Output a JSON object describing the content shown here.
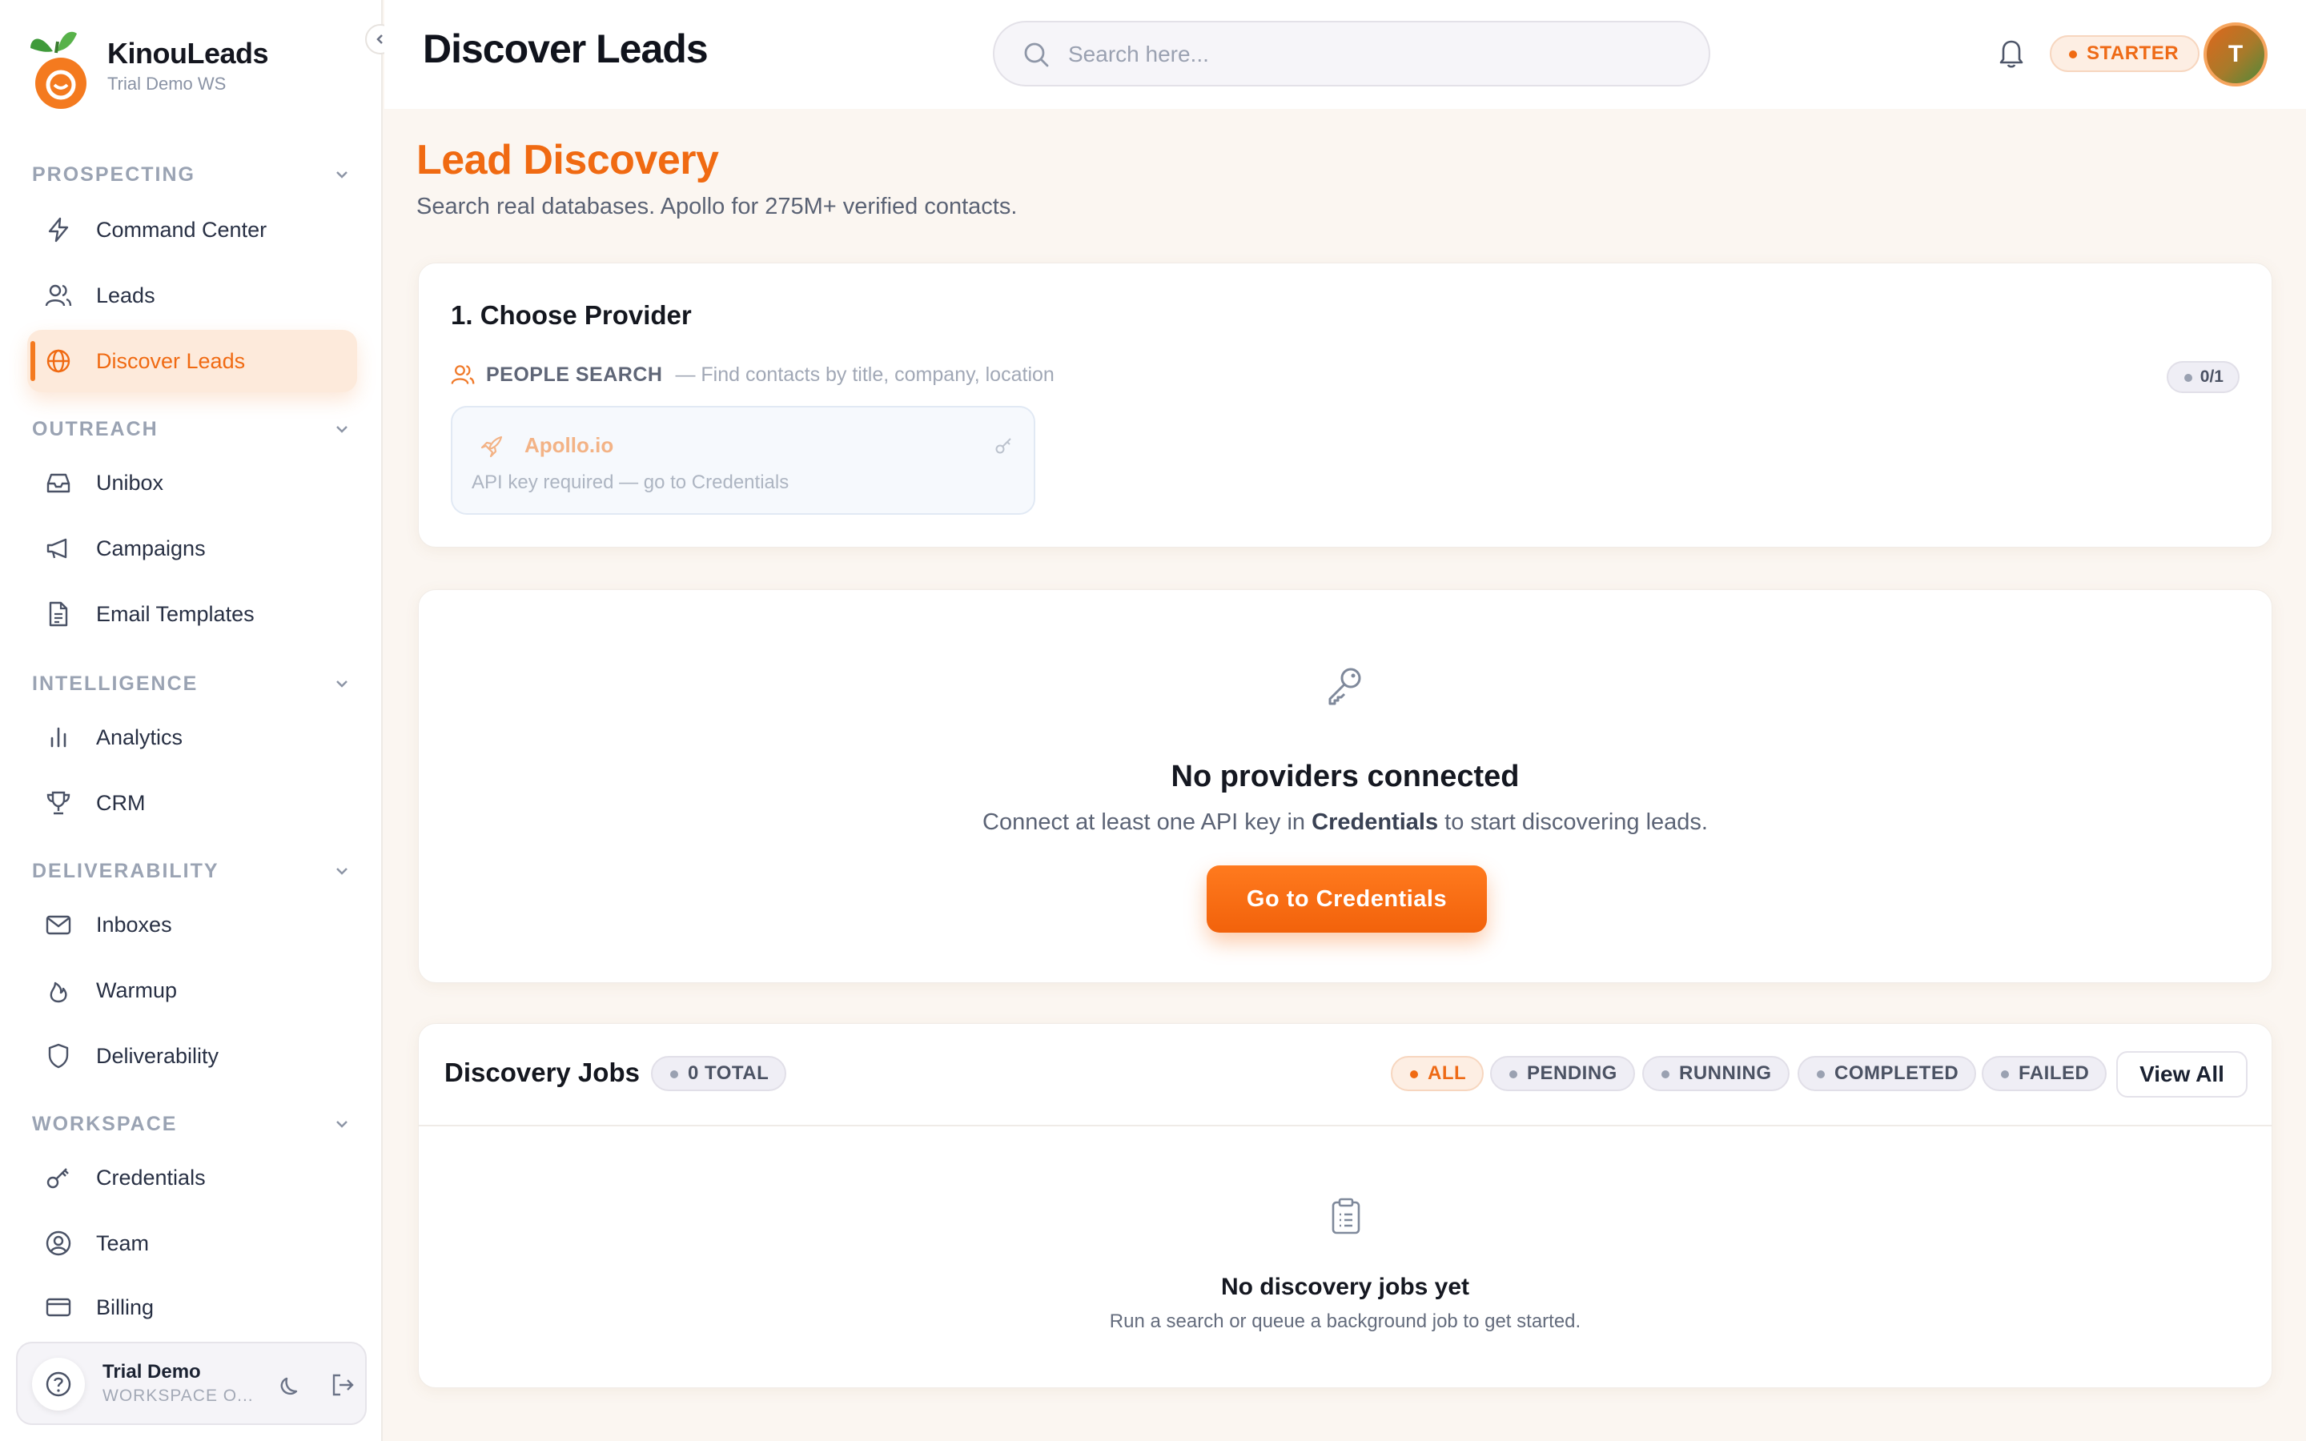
{
  "brand": {
    "name": "KinouLeads",
    "workspace": "Trial Demo WS"
  },
  "sidebar": {
    "sections": [
      {
        "label": "PROSPECTING",
        "items": [
          {
            "label": "Command Center",
            "icon": "bolt-icon"
          },
          {
            "label": "Leads",
            "icon": "users-icon"
          },
          {
            "label": "Discover Leads",
            "icon": "globe-icon",
            "active": true
          }
        ]
      },
      {
        "label": "OUTREACH",
        "items": [
          {
            "label": "Unibox",
            "icon": "inbox-icon"
          },
          {
            "label": "Campaigns",
            "icon": "megaphone-icon"
          },
          {
            "label": "Email Templates",
            "icon": "document-icon"
          }
        ]
      },
      {
        "label": "INTELLIGENCE",
        "items": [
          {
            "label": "Analytics",
            "icon": "bar-chart-icon"
          },
          {
            "label": "CRM",
            "icon": "trophy-icon"
          }
        ]
      },
      {
        "label": "DELIVERABILITY",
        "items": [
          {
            "label": "Inboxes",
            "icon": "mail-icon"
          },
          {
            "label": "Warmup",
            "icon": "flame-icon"
          },
          {
            "label": "Deliverability",
            "icon": "shield-icon"
          }
        ]
      },
      {
        "label": "WORKSPACE",
        "items": [
          {
            "label": "Credentials",
            "icon": "key-icon"
          },
          {
            "label": "Team",
            "icon": "user-circle-icon"
          },
          {
            "label": "Billing",
            "icon": "credit-card-icon"
          }
        ]
      }
    ],
    "user": {
      "name": "Trial Demo",
      "role": "WORKSPACE O..."
    }
  },
  "header": {
    "title": "Discover Leads",
    "search_placeholder": "Search here...",
    "plan": "STARTER",
    "avatar_initial": "T"
  },
  "main": {
    "heading": "Lead Discovery",
    "subheading": "Search real databases. Apollo for 275M+ verified contacts.",
    "provider_card": {
      "title": "1. Choose Provider",
      "people_search_label": "PEOPLE SEARCH",
      "people_search_desc": "— Find contacts by title, company, location",
      "counter": "0/1",
      "provider_name": "Apollo.io",
      "provider_note": "API key required — go to Credentials"
    },
    "empty_providers": {
      "title": "No providers connected",
      "desc_before": "Connect at least one API key in ",
      "desc_bold": "Credentials",
      "desc_after": " to start discovering leads.",
      "cta": "Go to Credentials"
    },
    "jobs": {
      "title": "Discovery Jobs",
      "total": "0 TOTAL",
      "filters": [
        "ALL",
        "PENDING",
        "RUNNING",
        "COMPLETED",
        "FAILED"
      ],
      "active_filter": "ALL",
      "view_all": "View All",
      "empty_title": "No discovery jobs yet",
      "empty_desc": "Run a search or queue a background job to get started."
    }
  },
  "colors": {
    "accent": "#f06a12",
    "background": "#fbf6f1"
  }
}
